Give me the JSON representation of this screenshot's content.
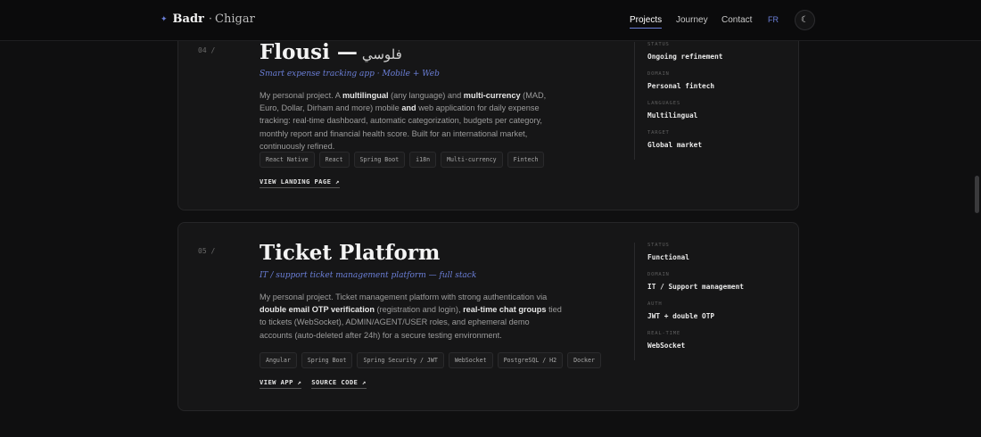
{
  "header": {
    "brand_first": "Badr",
    "brand_sep": "·",
    "brand_last": "Chigar",
    "nav": [
      "Projects",
      "Journey",
      "Contact"
    ],
    "lang": "FR",
    "theme_icon": "moon-icon"
  },
  "projects": [
    {
      "num": "04 /",
      "title": "Flousi —",
      "title_ar": "فلوسي",
      "subtitle": "Smart expense tracking app · Mobile + Web",
      "desc": [
        {
          "t": "My personal project. A "
        },
        {
          "t": "multilingual",
          "b": true
        },
        {
          "t": " (any language) and "
        },
        {
          "t": "multi-currency",
          "b": true
        },
        {
          "t": " (MAD, Euro, Dollar, Dirham and more) mobile "
        },
        {
          "t": "and",
          "b": true
        },
        {
          "t": " web application for daily expense tracking: real-time dashboard, automatic categorization, budgets per category, monthly report and financial health score. Built for an international market, continuously refined."
        }
      ],
      "tags": [
        "React Native",
        "React",
        "Spring Boot",
        "i18n",
        "Multi-currency",
        "Fintech"
      ],
      "links": [
        "VIEW LANDING PAGE ↗"
      ],
      "meta": [
        {
          "label": "STATUS",
          "value": "Ongoing refinement"
        },
        {
          "label": "DOMAIN",
          "value": "Personal fintech"
        },
        {
          "label": "LANGUAGES",
          "value": "Multilingual"
        },
        {
          "label": "TARGET",
          "value": "Global market"
        }
      ]
    },
    {
      "num": "05 /",
      "title": "Ticket Platform",
      "title_ar": "",
      "subtitle": "IT / support ticket management platform — full stack",
      "desc": [
        {
          "t": "My personal project. Ticket management platform with strong authentication via "
        },
        {
          "t": "double email OTP verification",
          "b": true
        },
        {
          "t": " (registration and login), "
        },
        {
          "t": "real-time chat groups",
          "b": true
        },
        {
          "t": " tied to tickets (WebSocket), ADMIN/AGENT/USER roles, and ephemeral demo accounts (auto-deleted after 24h) for a secure testing environment."
        }
      ],
      "tags": [
        "Angular",
        "Spring Boot",
        "Spring Security / JWT",
        "WebSocket",
        "PostgreSQL / H2",
        "Docker"
      ],
      "links": [
        "VIEW APP ↗",
        "SOURCE CODE ↗"
      ],
      "meta": [
        {
          "label": "STATUS",
          "value": "Functional"
        },
        {
          "label": "DOMAIN",
          "value": "IT / Support management"
        },
        {
          "label": "AUTH",
          "value": "JWT + double OTP"
        },
        {
          "label": "REAL-TIME",
          "value": "WebSocket"
        }
      ]
    }
  ]
}
